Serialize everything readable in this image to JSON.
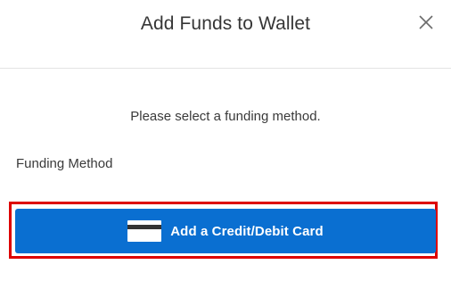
{
  "dialog": {
    "title": "Add Funds to Wallet",
    "close_icon": "close-icon",
    "prompt": "Please select a funding method.",
    "funding_method_label": "Funding Method",
    "add_card_button": {
      "label": "Add a Credit/Debit Card",
      "icon": "credit-card-icon"
    }
  },
  "colors": {
    "primary_button": "#0a6fd1",
    "highlight_border": "#dd0000"
  }
}
